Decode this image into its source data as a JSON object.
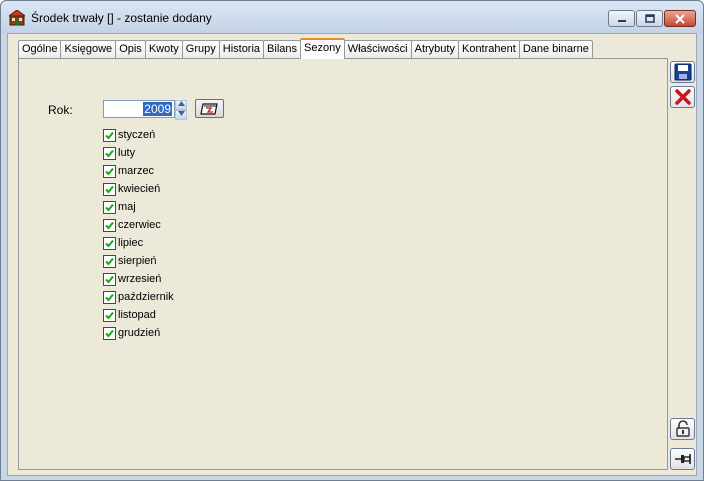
{
  "window": {
    "title": "Środek trwały [] - zostanie dodany"
  },
  "tabs": [
    {
      "label": "Ogólne"
    },
    {
      "label": "Księgowe"
    },
    {
      "label": "Opis"
    },
    {
      "label": "Kwoty"
    },
    {
      "label": "Grupy"
    },
    {
      "label": "Historia"
    },
    {
      "label": "Bilans"
    },
    {
      "label": "Sezony",
      "active": true
    },
    {
      "label": "Właściwości"
    },
    {
      "label": "Atrybuty"
    },
    {
      "label": "Kontrahent"
    },
    {
      "label": "Dane binarne"
    }
  ],
  "seasons": {
    "rok_label": "Rok:",
    "year_value": "2009",
    "months": [
      {
        "label": "styczeń",
        "checked": true
      },
      {
        "label": "luty",
        "checked": true
      },
      {
        "label": "marzec",
        "checked": true
      },
      {
        "label": "kwiecień",
        "checked": true
      },
      {
        "label": "maj",
        "checked": true
      },
      {
        "label": "czerwiec",
        "checked": true
      },
      {
        "label": "lipiec",
        "checked": true
      },
      {
        "label": "sierpień",
        "checked": true
      },
      {
        "label": "wrzesień",
        "checked": true
      },
      {
        "label": "październik",
        "checked": true
      },
      {
        "label": "listopad",
        "checked": true
      },
      {
        "label": "grudzień",
        "checked": true
      }
    ]
  },
  "icons": {
    "save": "save-icon",
    "cancel": "cancel-icon",
    "lock": "lock-icon",
    "pin": "pin-icon",
    "calendar": "calendar-icon"
  },
  "colors": {
    "panel_bg": "#ece9d8",
    "active_tab_accent": "#e68b2c",
    "selection": "#316ac5",
    "check": "#21a121"
  }
}
